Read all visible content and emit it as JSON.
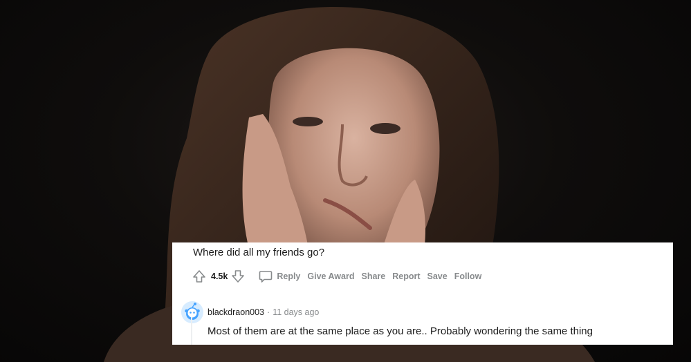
{
  "post": {
    "text": "Where did all my friends go?",
    "score": "4.5k",
    "actions": {
      "reply": "Reply",
      "give_award": "Give Award",
      "share": "Share",
      "report": "Report",
      "save": "Save",
      "follow": "Follow"
    }
  },
  "comment": {
    "username": "blackdraon003",
    "separator": "·",
    "timestamp": "11 days ago",
    "text": "Most of them are at the same place as you are.. Probably wondering the same thing"
  },
  "icons": {
    "upvote": "upvote-arrow-icon",
    "downvote": "downvote-arrow-icon",
    "reply": "comment-bubble-icon",
    "avatar": "snoo-avatar-icon"
  },
  "colors": {
    "card_background": "#ffffff",
    "primary_text": "#1c1c1c",
    "meta_text": "#878a8c",
    "avatar_blue": "#46a3ff",
    "photo_background": "#0d0d0d"
  }
}
